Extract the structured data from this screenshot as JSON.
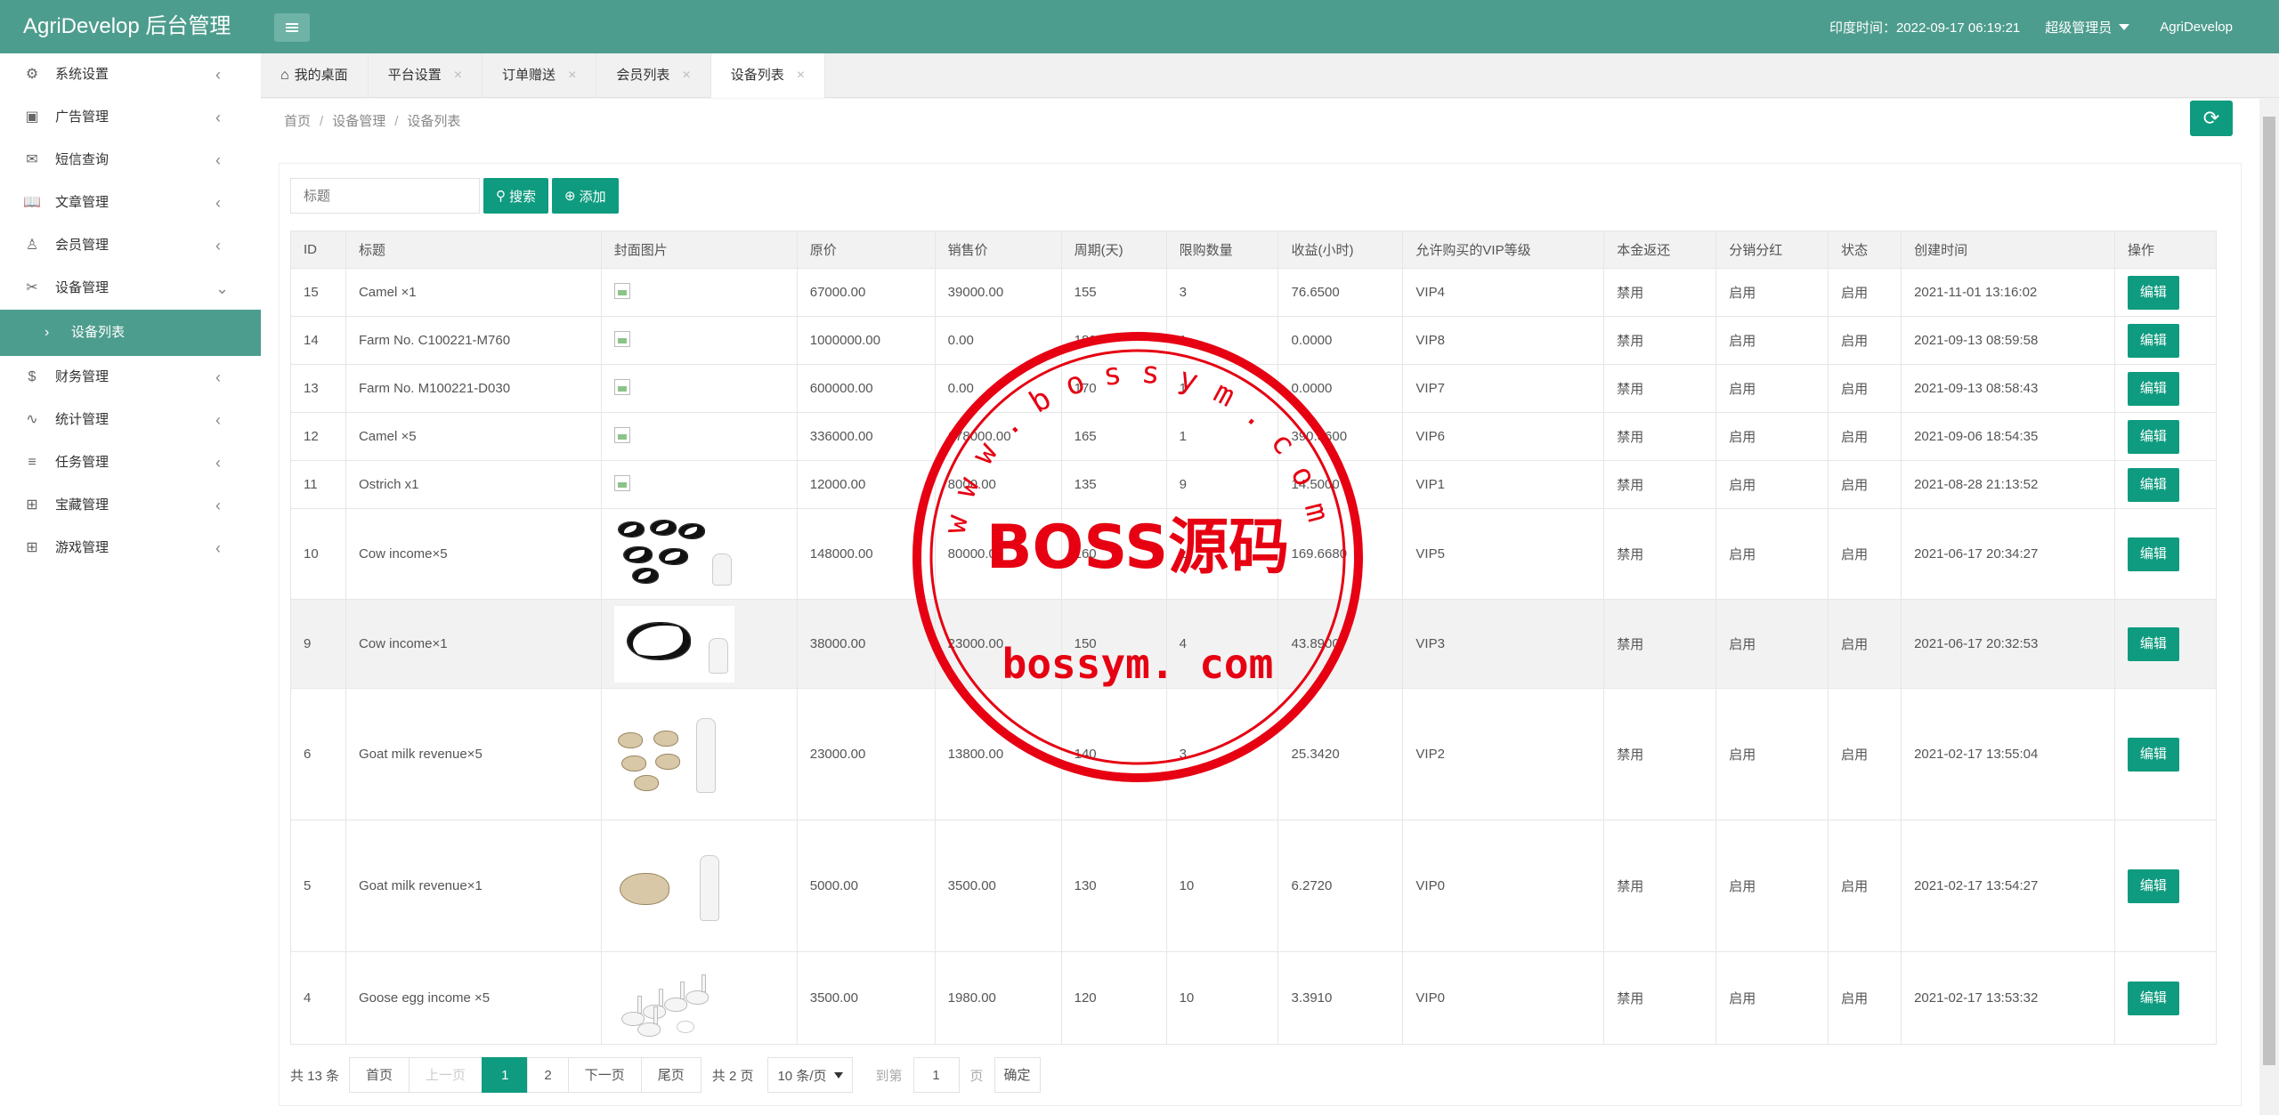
{
  "header": {
    "logo": "AgriDevelop 后台管理",
    "time": "印度时间：2022-09-17 06:19:21",
    "admin": "超级管理员",
    "site": "AgriDevelop"
  },
  "sidebar": {
    "items": [
      {
        "label": "系统设置",
        "icon": "gear-icon"
      },
      {
        "label": "广告管理",
        "icon": "image-icon"
      },
      {
        "label": "短信查询",
        "icon": "mail-icon"
      },
      {
        "label": "文章管理",
        "icon": "book-icon"
      },
      {
        "label": "会员管理",
        "icon": "user-icon"
      },
      {
        "label": "设备管理",
        "icon": "tools-icon"
      }
    ],
    "sub_item": "设备列表",
    "items_after": [
      {
        "label": "财务管理",
        "icon": "dollar-icon"
      },
      {
        "label": "统计管理",
        "icon": "pulse-icon"
      },
      {
        "label": "任务管理",
        "icon": "sliders-icon"
      },
      {
        "label": "宝藏管理",
        "icon": "gift-icon"
      },
      {
        "label": "游戏管理",
        "icon": "gift-icon"
      }
    ]
  },
  "tabs": [
    "我的桌面",
    "平台设置",
    "订单赠送",
    "会员列表",
    "设备列表"
  ],
  "breadcrumb": [
    "首页",
    "设备管理",
    "设备列表"
  ],
  "search": {
    "placeholder": "标题",
    "search_label": "搜索",
    "add_label": "添加"
  },
  "table": {
    "headers": [
      "ID",
      "标题",
      "封面图片",
      "原价",
      "销售价",
      "周期(天)",
      "限购数量",
      "收益(小时)",
      "允许购买的VIP等级",
      "本金返还",
      "分销分红",
      "状态",
      "创建时间",
      "操作"
    ],
    "rows": [
      {
        "id": "15",
        "title": "Camel ×1",
        "image": "broken",
        "price": "67000.00",
        "sale": "39000.00",
        "cycle": "155",
        "limit": "3",
        "income": "76.6500",
        "vip": "VIP4",
        "refund": "禁用",
        "share": "启用",
        "status": "启用",
        "created": "2021-11-01 13:16:02",
        "action": "编辑"
      },
      {
        "id": "14",
        "title": "Farm No. C100221-M760",
        "image": "broken",
        "price": "1000000.00",
        "sale": "0.00",
        "cycle": "180",
        "limit": "1",
        "income": "0.0000",
        "vip": "VIP8",
        "refund": "禁用",
        "share": "启用",
        "status": "启用",
        "created": "2021-09-13 08:59:58",
        "action": "编辑"
      },
      {
        "id": "13",
        "title": "Farm No. M100221-D030",
        "image": "broken",
        "price": "600000.00",
        "sale": "0.00",
        "cycle": "170",
        "limit": "1",
        "income": "0.0000",
        "vip": "VIP7",
        "refund": "禁用",
        "share": "启用",
        "status": "启用",
        "created": "2021-09-13 08:58:43",
        "action": "编辑"
      },
      {
        "id": "12",
        "title": "Camel ×5",
        "image": "broken",
        "price": "336000.00",
        "sale": "178000.00",
        "cycle": "165",
        "limit": "1",
        "income": "390.3600",
        "vip": "VIP6",
        "refund": "禁用",
        "share": "启用",
        "status": "启用",
        "created": "2021-09-06 18:54:35",
        "action": "编辑"
      },
      {
        "id": "11",
        "title": "Ostrich x1",
        "image": "broken",
        "price": "12000.00",
        "sale": "8000.00",
        "cycle": "135",
        "limit": "9",
        "income": "14.5000",
        "vip": "VIP1",
        "refund": "禁用",
        "share": "启用",
        "status": "启用",
        "created": "2021-08-28 21:13:52",
        "action": "编辑"
      },
      {
        "id": "10",
        "title": "Cow income×5",
        "image": "cows5",
        "price": "148000.00",
        "sale": "80000.00",
        "cycle": "160",
        "limit": "1",
        "income": "169.6680",
        "vip": "VIP5",
        "refund": "禁用",
        "share": "启用",
        "status": "启用",
        "created": "2021-06-17 20:34:27",
        "action": "编辑"
      },
      {
        "id": "9",
        "title": "Cow income×1",
        "image": "cow1",
        "price": "38000.00",
        "sale": "23000.00",
        "cycle": "150",
        "limit": "4",
        "income": "43.8900",
        "vip": "VIP3",
        "refund": "禁用",
        "share": "启用",
        "status": "启用",
        "created": "2021-06-17 20:32:53",
        "action": "编辑"
      },
      {
        "id": "6",
        "title": "Goat milk revenue×5",
        "image": "goats5",
        "price": "23000.00",
        "sale": "13800.00",
        "cycle": "140",
        "limit": "3",
        "income": "25.3420",
        "vip": "VIP2",
        "refund": "禁用",
        "share": "启用",
        "status": "启用",
        "created": "2021-02-17 13:55:04",
        "action": "编辑"
      },
      {
        "id": "5",
        "title": "Goat milk revenue×1",
        "image": "goat1",
        "price": "5000.00",
        "sale": "3500.00",
        "cycle": "130",
        "limit": "10",
        "income": "6.2720",
        "vip": "VIP0",
        "refund": "禁用",
        "share": "启用",
        "status": "启用",
        "created": "2021-02-17 13:54:27",
        "action": "编辑"
      },
      {
        "id": "4",
        "title": "Goose egg income ×5",
        "image": "geese",
        "price": "3500.00",
        "sale": "1980.00",
        "cycle": "120",
        "limit": "10",
        "income": "3.3910",
        "vip": "VIP0",
        "refund": "禁用",
        "share": "启用",
        "status": "启用",
        "created": "2021-02-17 13:53:32",
        "action": "编辑"
      }
    ]
  },
  "pager": {
    "total": "共 13 条",
    "first": "首页",
    "prev": "上一页",
    "pages": [
      "1",
      "2"
    ],
    "next": "下一页",
    "last": "尾页",
    "page_count": "共 2 页",
    "per_page": "10 条/页",
    "goto": "到第",
    "goto_value": "1",
    "page_unit": "页",
    "confirm": "确定"
  },
  "watermark": {
    "text": "BOSS源码",
    "domain": "bossym. com",
    "ring_text": "w w w . b o s s y m . c o m"
  },
  "colors": {
    "brand": "#4d9d8e",
    "button": "#0f9b7f",
    "enabled": "#2aa67c",
    "stamp": "#e60012"
  }
}
